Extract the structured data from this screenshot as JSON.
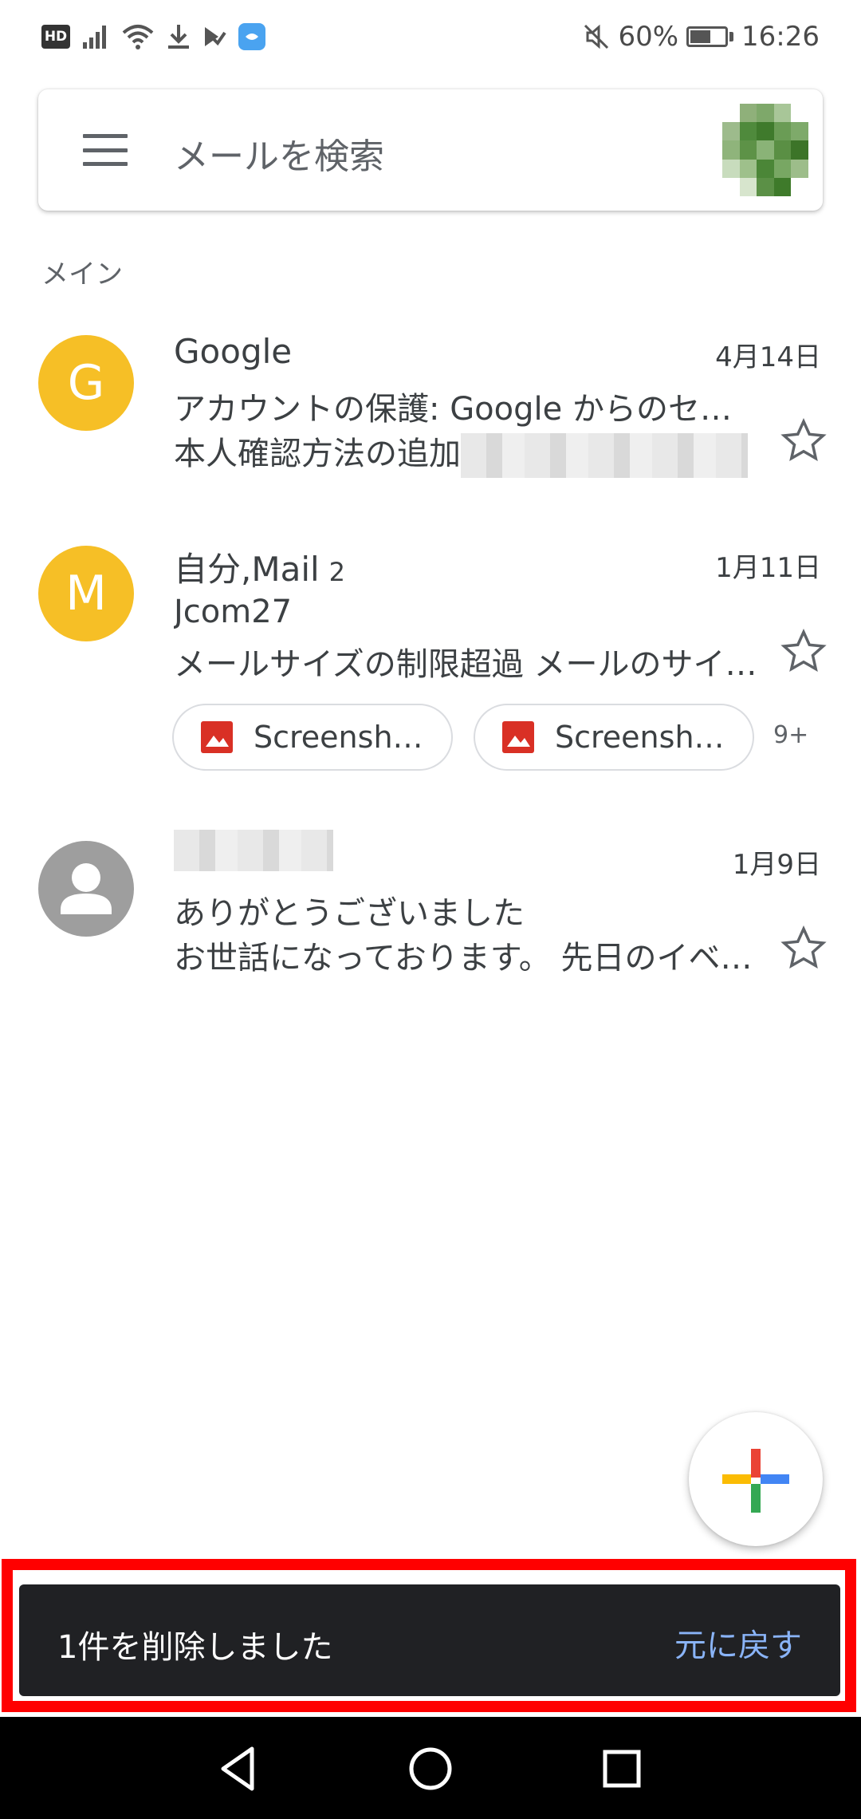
{
  "status_bar": {
    "hd": "HD",
    "battery": "60%",
    "time": "16:26"
  },
  "search": {
    "placeholder": "メールを検索"
  },
  "section_label": "メイン",
  "mails": [
    {
      "avatar_letter": "G",
      "avatar_color": "#f6bf26",
      "sender": "Google",
      "date": "4月14日",
      "subject": "アカウントの保護: Google からのセ…",
      "snippet": "本人確認方法の追加"
    },
    {
      "avatar_letter": "M",
      "avatar_color": "#f6bf26",
      "sender": "自分,Mail",
      "count": "2",
      "date": "1月11日",
      "subject": "Jcom27",
      "snippet": "メールサイズの制限超過 メールのサイ…",
      "attachments": [
        "Screensh…",
        "Screensh…"
      ],
      "more_attachments": "9+"
    },
    {
      "avatar_icon": "person-icon",
      "avatar_color": "#9e9e9e",
      "date": "1月9日",
      "subject": "ありがとうございました",
      "snippet": "お世話になっております。 先日のイベ…"
    }
  ],
  "snackbar": {
    "message": "1件を削除しました",
    "action": "元に戻す",
    "highlight_color": "#ff0000"
  },
  "colors": {
    "snackbar_bg": "#202124",
    "snackbar_action": "#8ab4f8"
  }
}
